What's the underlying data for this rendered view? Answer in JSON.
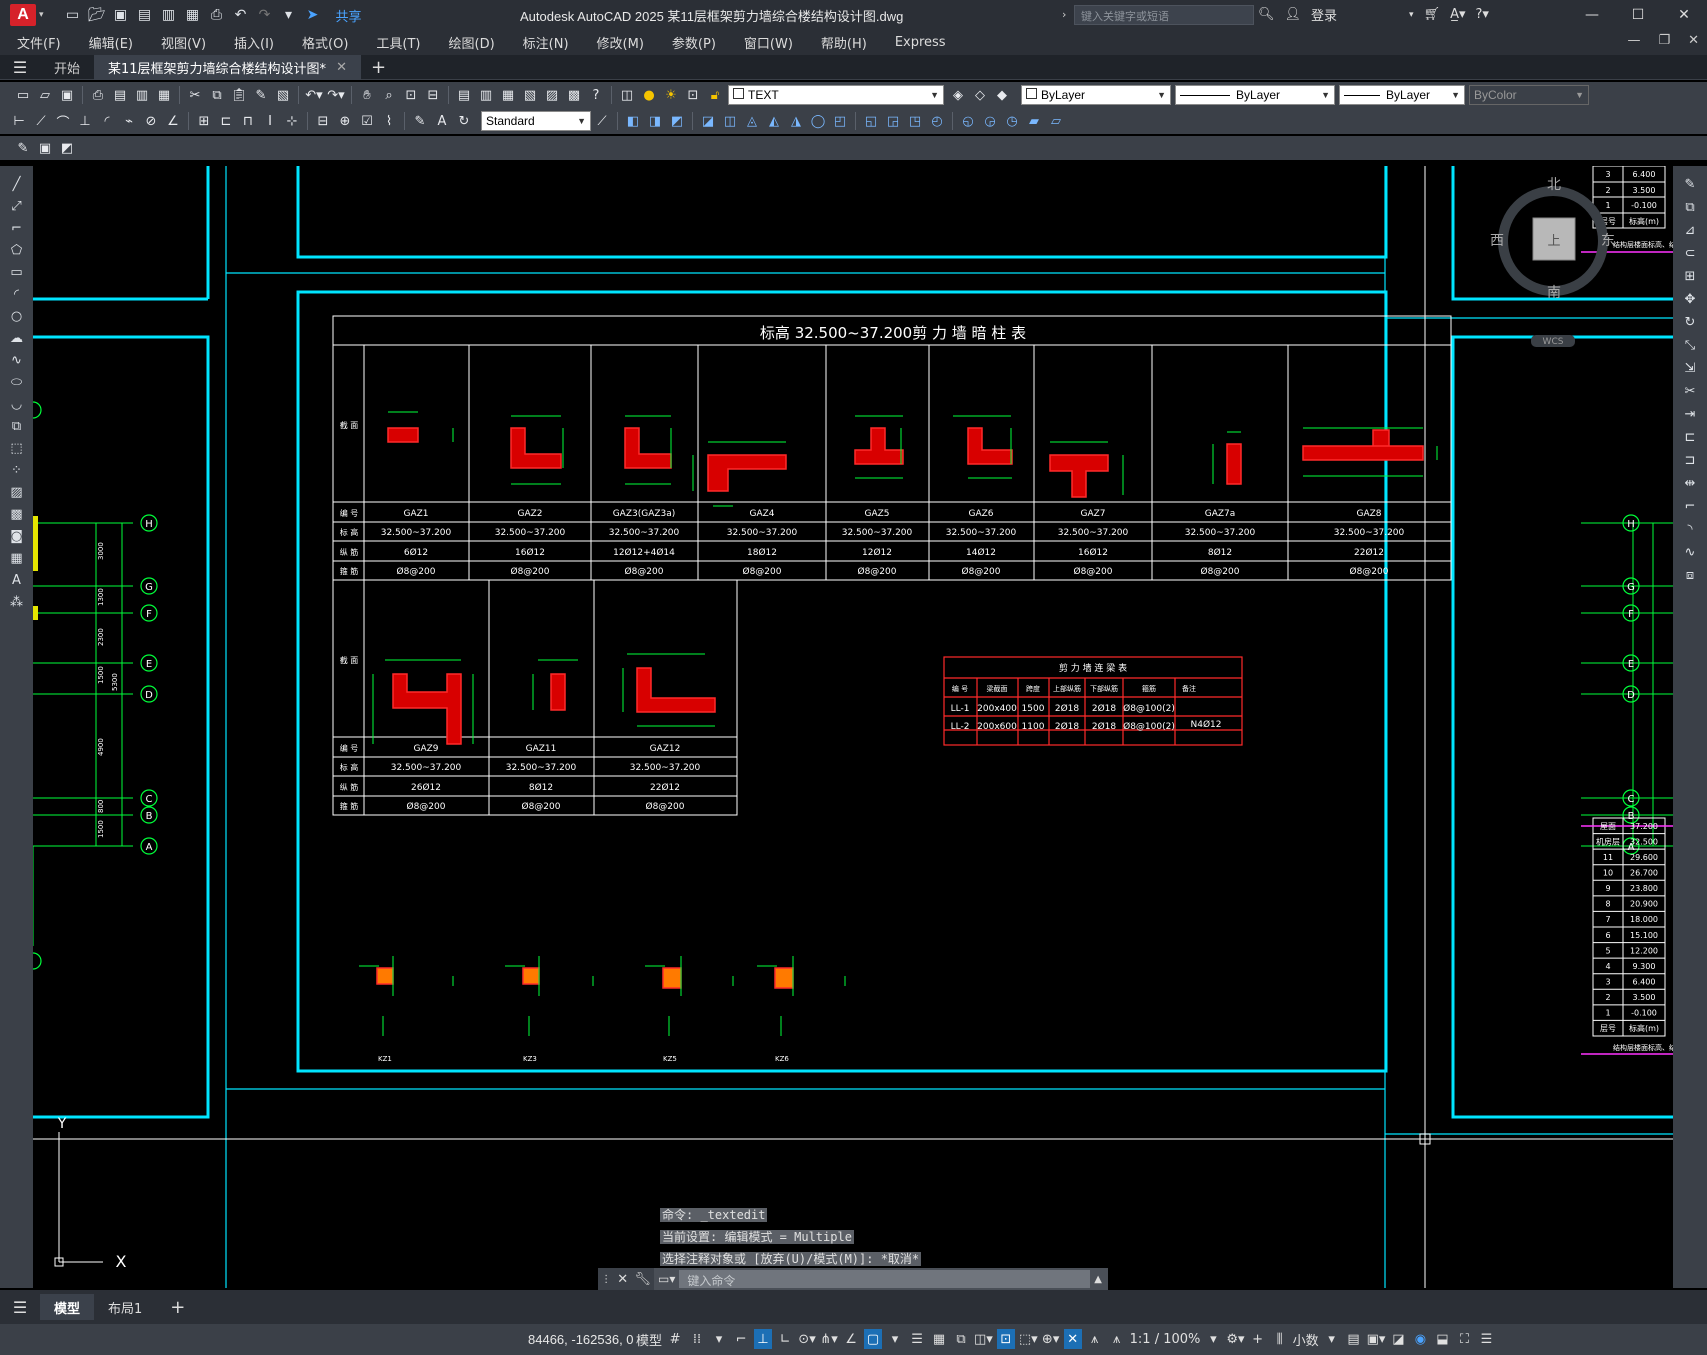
{
  "app": {
    "logo": "A",
    "title": "Autodesk AutoCAD 2025    某11层框架剪力墙综合楼结构设计图.dwg",
    "share_label": "共享",
    "search_placeholder": "键入关键字或短语",
    "login_label": "登录"
  },
  "menu": [
    "文件(F)",
    "编辑(E)",
    "视图(V)",
    "插入(I)",
    "格式(O)",
    "工具(T)",
    "绘图(D)",
    "标注(N)",
    "修改(M)",
    "参数(P)",
    "窗口(W)",
    "帮助(H)",
    "Express"
  ],
  "tabs": {
    "start": "开始",
    "active": "某11层框架剪力墙综合楼结构设计图*"
  },
  "toolbar": {
    "layer_name": "TEXT",
    "color": "ByLayer",
    "linetype": "ByLayer",
    "lineweight": "ByLayer",
    "plotstyle": "ByColor",
    "textstyle": "Standard"
  },
  "drawing": {
    "table_title": "标高 32.500~37.200剪 力 墙 暗 柱 表",
    "row_labels": {
      "section": "截 面",
      "id": "编 号",
      "elevation": "标 高",
      "long_bar": "纵 筋",
      "stirrup": "箍 筋"
    },
    "columns1": [
      {
        "id": "GAZ1",
        "elev": "32.500~37.200",
        "bar": "6Ø12",
        "stir": "Ø8@200"
      },
      {
        "id": "GAZ2",
        "elev": "32.500~37.200",
        "bar": "16Ø12",
        "stir": "Ø8@200"
      },
      {
        "id": "GAZ3(GAZ3a)",
        "elev": "32.500~37.200",
        "bar": "12Ø12+4Ø14",
        "stir": "Ø8@200"
      },
      {
        "id": "GAZ4",
        "elev": "32.500~37.200",
        "bar": "18Ø12",
        "stir": "Ø8@200"
      },
      {
        "id": "GAZ5",
        "elev": "32.500~37.200",
        "bar": "12Ø12",
        "stir": "Ø8@200"
      },
      {
        "id": "GAZ6",
        "elev": "32.500~37.200",
        "bar": "14Ø12",
        "stir": "Ø8@200"
      },
      {
        "id": "GAZ7",
        "elev": "32.500~37.200",
        "bar": "16Ø12",
        "stir": "Ø8@200"
      },
      {
        "id": "GAZ7a",
        "elev": "32.500~37.200",
        "bar": "8Ø12",
        "stir": "Ø8@200"
      },
      {
        "id": "GAZ8",
        "elev": "32.500~37.200",
        "bar": "22Ø12",
        "stir": "Ø8@200"
      }
    ],
    "columns2": [
      {
        "id": "GAZ9",
        "elev": "32.500~37.200",
        "bar": "26Ø12",
        "stir": "Ø8@200"
      },
      {
        "id": "GAZ11",
        "elev": "32.500~37.200",
        "bar": "8Ø12",
        "stir": "Ø8@200"
      },
      {
        "id": "GAZ12",
        "elev": "32.500~37.200",
        "bar": "22Ø12",
        "stir": "Ø8@200"
      }
    ],
    "beam_table": {
      "title": "剪 力 墙 连 梁 表",
      "headers": [
        "编 号",
        "梁截面",
        "跨度",
        "上部纵筋",
        "下部纵筋",
        "箍筋",
        "备注"
      ],
      "rows": [
        [
          "LL-1",
          "200x400",
          "1500",
          "2Ø18",
          "2Ø18",
          "Ø8@100(2)",
          ""
        ],
        [
          "LL-2",
          "200x600",
          "1100",
          "2Ø18",
          "2Ø18",
          "Ø8@100(2)",
          "N4Ø12"
        ]
      ]
    },
    "kz_labels": [
      "KZ1",
      "KZ3",
      "KZ5",
      "KZ6"
    ],
    "axes_left": [
      "H",
      "G",
      "F",
      "E",
      "D",
      "C",
      "B",
      "A"
    ],
    "dims_left": [
      "3000",
      "1300",
      "2300",
      "1500",
      "5300",
      "4900",
      "800",
      "1500"
    ],
    "floor_table_top": [
      [
        "3",
        "6.400"
      ],
      [
        "2",
        "3.500"
      ],
      [
        "1",
        "-0.100"
      ],
      [
        "层号",
        "标高(m)"
      ]
    ],
    "floor_table_bottom": [
      [
        "屋面",
        "37.200"
      ],
      [
        "机房层",
        "32.500"
      ],
      [
        "11",
        "29.600"
      ],
      [
        "10",
        "26.700"
      ],
      [
        "9",
        "23.800"
      ],
      [
        "8",
        "20.900"
      ],
      [
        "7",
        "18.000"
      ],
      [
        "6",
        "15.100"
      ],
      [
        "5",
        "12.200"
      ],
      [
        "4",
        "9.300"
      ],
      [
        "3",
        "6.400"
      ],
      [
        "2",
        "3.500"
      ],
      [
        "1",
        "-0.100"
      ],
      [
        "层号",
        "标高(m)"
      ]
    ],
    "floor_note": "结构层楼面标高、结构层高",
    "compass": {
      "north": "北",
      "south": "南",
      "east": "东",
      "west": "西",
      "top": "上",
      "wcs": "WCS"
    },
    "ucs": {
      "x": "X",
      "y": "Y"
    }
  },
  "command": {
    "history": [
      "命令: _textedit",
      "当前设置: 编辑模式 = Multiple",
      "选择注释对象或 [放弃(U)/模式(M)]: *取消*"
    ],
    "placeholder": "键入命令"
  },
  "layouts": {
    "model": "模型",
    "layout1": "布局1"
  },
  "status": {
    "coords": "84466, -162536, 0",
    "model": "模型",
    "scale": "1:1 / 100%",
    "units": "小数"
  }
}
